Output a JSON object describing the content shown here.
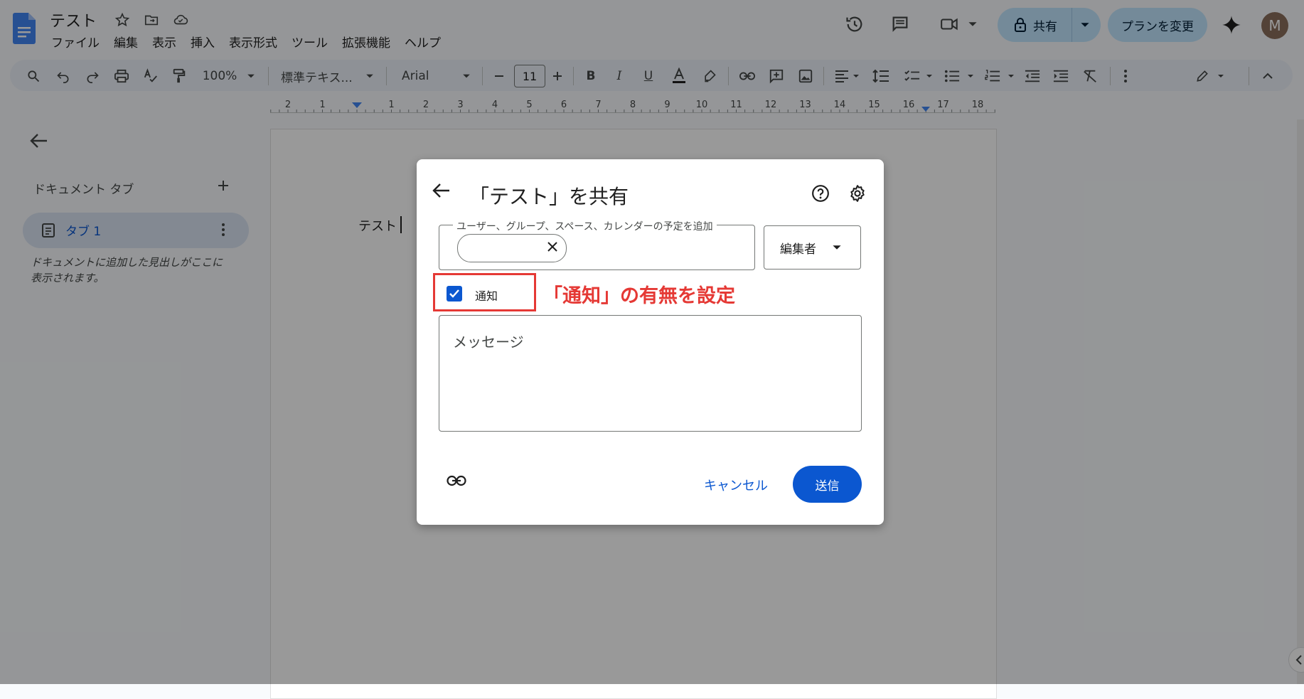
{
  "header": {
    "doc_title": "テスト",
    "menu": [
      "ファイル",
      "編集",
      "表示",
      "挿入",
      "表示形式",
      "ツール",
      "拡張機能",
      "ヘルプ"
    ],
    "share_label": "共有",
    "plan_label": "プランを変更",
    "avatar_initial": "M"
  },
  "toolbar": {
    "zoom": "100%",
    "style": "標準テキス...",
    "font": "Arial",
    "font_size": "11"
  },
  "ruler": {
    "ticks": [
      "2",
      "1",
      "1",
      "2",
      "3",
      "4",
      "5",
      "6",
      "7",
      "8",
      "9",
      "10",
      "11",
      "12",
      "13",
      "14",
      "15",
      "16",
      "17",
      "18"
    ]
  },
  "sidebar": {
    "heading": "ドキュメント タブ",
    "tab_label": "タブ 1",
    "hint": "ドキュメントに追加した見出しがここに表示されます。"
  },
  "page": {
    "body_text": "テスト"
  },
  "dialog": {
    "title": "「テスト」を共有",
    "recipients_label": "ユーザー、グループ、スペース、カレンダーの予定を追加",
    "role": "編集者",
    "notify_label": "通知",
    "notify_checked": true,
    "message_placeholder": "メッセージ",
    "cancel_label": "キャンセル",
    "send_label": "送信"
  },
  "annotation": {
    "text": "「通知」の有無を設定",
    "color": "#e53935"
  },
  "colors": {
    "accent": "#0b57d0",
    "share_bg": "#c2e7ff"
  }
}
